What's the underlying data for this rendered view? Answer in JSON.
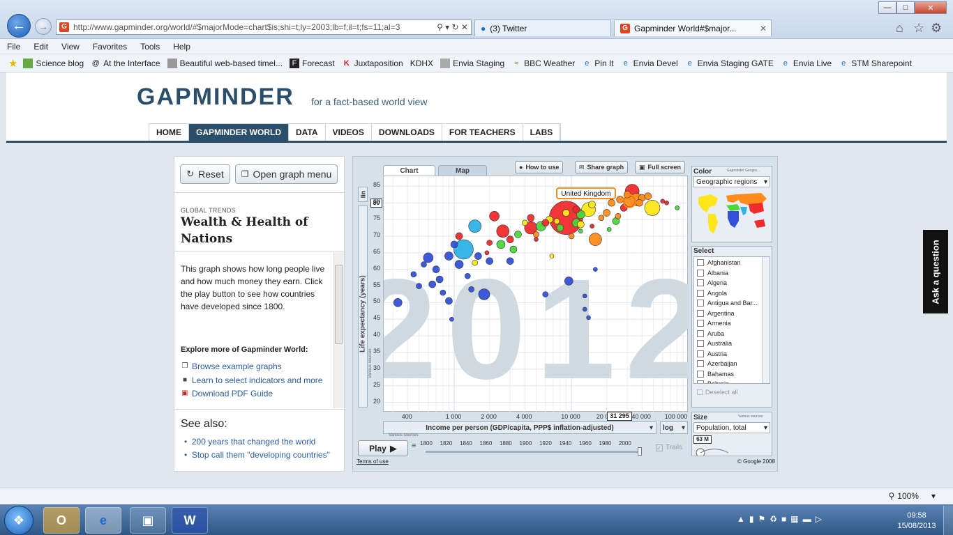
{
  "browser": {
    "url": "http://www.gapminder.org/world/#$majorMode=chart$is;shi=t;ly=2003;lb=f;il=t;fs=11;al=3",
    "tabs": [
      {
        "title": "(3) Twitter"
      },
      {
        "title": "Gapminder World#$major..."
      }
    ],
    "menu": [
      "File",
      "Edit",
      "View",
      "Favorites",
      "Tools",
      "Help"
    ],
    "favorites": [
      "Science blog",
      "At the Interface",
      "Beautiful web-based timel...",
      "Forecast",
      "Juxtaposition",
      "KDHX",
      "Envia Staging",
      "BBC Weather",
      "Pin It",
      "Envia Devel",
      "Envia Staging GATE",
      "Envia Live",
      "STM Sharepoint"
    ],
    "zoom": "100%"
  },
  "site": {
    "logo": "GAPMINDER",
    "tagline": "for a fact-based world view",
    "nav": [
      "HOME",
      "GAPMINDER WORLD",
      "DATA",
      "VIDEOS",
      "DOWNLOADS",
      "FOR TEACHERS",
      "LABS"
    ]
  },
  "left": {
    "reset_label": "Reset",
    "menu_label": "Open graph menu",
    "kicker": "GLOBAL TRENDS",
    "title": "Wealth & Health of Nations",
    "description": "This graph shows how long people live and how much money they earn. Click the play button to see how countries have developed since 1800.",
    "explore": "Explore more of Gapminder World:",
    "links": [
      "Browse example graphs",
      "Learn to select indicators and more",
      "Download PDF Guide"
    ],
    "see_also": "See also:",
    "see_links": [
      "200 years that changed the world",
      "Stop call them \"developing countries\""
    ]
  },
  "widget": {
    "tabs": [
      "Chart",
      "Map"
    ],
    "buttons": [
      "How to use",
      "Share graph",
      "Full screen"
    ],
    "year_watermark": "2012",
    "y_scale": "lin",
    "y_marker": "80",
    "x_marker": "31 295",
    "highlight_label": "United Kingdom",
    "x_axis_select": "Income per person (GDP/capita, PPP$ inflation-adjusted)",
    "x_scale": "log",
    "sources": "Various sources",
    "play": "Play",
    "timeline_years": [
      "1800",
      "1820",
      "1840",
      "1860",
      "1880",
      "1900",
      "1920",
      "1940",
      "1960",
      "1980",
      "2000"
    ],
    "trails": "Trails",
    "terms": "Terms of use",
    "copyright": "© Google 2008",
    "color_title": "Color",
    "color_note": "Gapminder Geogra...",
    "color_select": "Geographic regions",
    "select_title": "Select",
    "countries": [
      "Afghanistan",
      "Albania",
      "Algeria",
      "Angola",
      "Antigua and Bar...",
      "Argentina",
      "Armenia",
      "Aruba",
      "Australia",
      "Austria",
      "Azerbaijan",
      "Bahamas",
      "Bahrain"
    ],
    "deselect": "Deselect all",
    "size_title": "Size",
    "size_select": "Population, total",
    "size_marker": "63 M"
  },
  "ask": "Ask a question",
  "taskbar": {
    "time": "09:58",
    "date": "15/08/2013"
  },
  "chart_data": {
    "type": "scatter",
    "title": "",
    "xlabel": "Income per person (GDP/capita, PPP$ inflation-adjusted)",
    "ylabel": "Life expectancy (years)",
    "x_scale": "log",
    "xlim": [
      250,
      100000
    ],
    "ylim": [
      17,
      88
    ],
    "x_ticks": [
      "400",
      "1 000",
      "2 000",
      "4 000",
      "10 000",
      "20 000",
      "40 000",
      "100 000"
    ],
    "x_tick_values": [
      400,
      1000,
      2000,
      4000,
      10000,
      20000,
      40000,
      100000
    ],
    "y_ticks": [
      85,
      80,
      75,
      70,
      65,
      60,
      55,
      50,
      45,
      40,
      35,
      30,
      25,
      20
    ],
    "year": "2012",
    "colors": {
      "Sub-Saharan Africa": "#3450d8",
      "South Asia": "#2db3e6",
      "Middle East & N. Africa": "#4cd63c",
      "America": "#ffe61a",
      "Europe & Central Asia": "#ff8c1a",
      "East Asia & Pacific": "#ef2b2b"
    },
    "points": [
      {
        "x": 1200,
        "y": 66,
        "r": 14,
        "c": "#2db3e6"
      },
      {
        "x": 9000,
        "y": 75.5,
        "r": 24,
        "c": "#ef2b2b"
      },
      {
        "x": 1500,
        "y": 73,
        "r": 9,
        "c": "#2db3e6"
      },
      {
        "x": 14000,
        "y": 78,
        "r": 10,
        "c": "#ffe61a"
      },
      {
        "x": 49000,
        "y": 78.5,
        "r": 11,
        "c": "#ffe61a"
      },
      {
        "x": 36000,
        "y": 81,
        "r": 9,
        "c": "#ff8c1a"
      },
      {
        "x": 31295,
        "y": 80.5,
        "r": 8,
        "c": "#ff8c1a"
      },
      {
        "x": 33000,
        "y": 83.5,
        "r": 10,
        "c": "#ef2b2b"
      },
      {
        "x": 16000,
        "y": 69,
        "r": 9,
        "c": "#ff8c1a"
      },
      {
        "x": 2600,
        "y": 71.5,
        "r": 9,
        "c": "#ef2b2b"
      },
      {
        "x": 4500,
        "y": 72.5,
        "r": 9,
        "c": "#ef2b2b"
      },
      {
        "x": 2200,
        "y": 76,
        "r": 7,
        "c": "#ef2b2b"
      },
      {
        "x": 1800,
        "y": 52.5,
        "r": 8,
        "c": "#3450d8"
      },
      {
        "x": 9500,
        "y": 56.5,
        "r": 6,
        "c": "#3450d8"
      },
      {
        "x": 330,
        "y": 50,
        "r": 6,
        "c": "#3450d8"
      },
      {
        "x": 600,
        "y": 63.5,
        "r": 7,
        "c": "#3450d8"
      },
      {
        "x": 900,
        "y": 64,
        "r": 6,
        "c": "#3450d8"
      },
      {
        "x": 1100,
        "y": 61.5,
        "r": 6,
        "c": "#3450d8"
      },
      {
        "x": 700,
        "y": 60,
        "r": 5,
        "c": "#3450d8"
      },
      {
        "x": 750,
        "y": 57,
        "r": 5,
        "c": "#3450d8"
      },
      {
        "x": 650,
        "y": 55.5,
        "r": 5,
        "c": "#3450d8"
      },
      {
        "x": 900,
        "y": 50.5,
        "r": 5,
        "c": "#3450d8"
      },
      {
        "x": 450,
        "y": 58.5,
        "r": 4,
        "c": "#3450d8"
      },
      {
        "x": 500,
        "y": 55,
        "r": 4,
        "c": "#3450d8"
      },
      {
        "x": 800,
        "y": 53,
        "r": 4,
        "c": "#3450d8"
      },
      {
        "x": 1300,
        "y": 58,
        "r": 4,
        "c": "#3450d8"
      },
      {
        "x": 1600,
        "y": 64,
        "r": 5,
        "c": "#3450d8"
      },
      {
        "x": 2000,
        "y": 62.5,
        "r": 5,
        "c": "#3450d8"
      },
      {
        "x": 1400,
        "y": 54,
        "r": 4,
        "c": "#3450d8"
      },
      {
        "x": 550,
        "y": 61.5,
        "r": 4,
        "c": "#3450d8"
      },
      {
        "x": 1000,
        "y": 67.5,
        "r": 5,
        "c": "#3450d8"
      },
      {
        "x": 3000,
        "y": 62.5,
        "r": 5,
        "c": "#3450d8"
      },
      {
        "x": 13000,
        "y": 52,
        "r": 3,
        "c": "#3450d8"
      },
      {
        "x": 13000,
        "y": 48,
        "r": 3,
        "c": "#3450d8"
      },
      {
        "x": 14000,
        "y": 45.5,
        "r": 3,
        "c": "#3450d8"
      },
      {
        "x": 16000,
        "y": 60,
        "r": 3,
        "c": "#3450d8"
      },
      {
        "x": 6000,
        "y": 52.5,
        "r": 4,
        "c": "#3450d8"
      },
      {
        "x": 950,
        "y": 45,
        "r": 3,
        "c": "#3450d8"
      },
      {
        "x": 2500,
        "y": 67.5,
        "r": 6,
        "c": "#4cd63c"
      },
      {
        "x": 5500,
        "y": 73,
        "r": 7,
        "c": "#4cd63c"
      },
      {
        "x": 11000,
        "y": 74,
        "r": 6,
        "c": "#4cd63c"
      },
      {
        "x": 8000,
        "y": 72.5,
        "r": 5,
        "c": "#4cd63c"
      },
      {
        "x": 12000,
        "y": 76.5,
        "r": 6,
        "c": "#4cd63c"
      },
      {
        "x": 3500,
        "y": 70.5,
        "r": 5,
        "c": "#4cd63c"
      },
      {
        "x": 3200,
        "y": 66,
        "r": 5,
        "c": "#4cd63c"
      },
      {
        "x": 6500,
        "y": 75,
        "r": 5,
        "c": "#ffe61a"
      },
      {
        "x": 9000,
        "y": 77,
        "r": 5,
        "c": "#ffe61a"
      },
      {
        "x": 15000,
        "y": 79.5,
        "r": 5,
        "c": "#ffe61a"
      },
      {
        "x": 4000,
        "y": 74,
        "r": 4,
        "c": "#ffe61a"
      },
      {
        "x": 7500,
        "y": 74.5,
        "r": 4,
        "c": "#ffe61a"
      },
      {
        "x": 12000,
        "y": 73.5,
        "r": 5,
        "c": "#ffe61a"
      },
      {
        "x": 1500,
        "y": 62,
        "r": 4,
        "c": "#ffe61a"
      },
      {
        "x": 25000,
        "y": 76,
        "r": 4,
        "c": "#ff8c1a"
      },
      {
        "x": 20000,
        "y": 77,
        "r": 5,
        "c": "#ff8c1a"
      },
      {
        "x": 26000,
        "y": 81,
        "r": 5,
        "c": "#ff8c1a"
      },
      {
        "x": 40000,
        "y": 81.5,
        "r": 5,
        "c": "#ff8c1a"
      },
      {
        "x": 45000,
        "y": 82,
        "r": 5,
        "c": "#ff8c1a"
      },
      {
        "x": 22000,
        "y": 80,
        "r": 5,
        "c": "#ff8c1a"
      },
      {
        "x": 18000,
        "y": 75.5,
        "r": 4,
        "c": "#ff8c1a"
      },
      {
        "x": 10000,
        "y": 70,
        "r": 4,
        "c": "#ff8c1a"
      },
      {
        "x": 5000,
        "y": 70.5,
        "r": 4,
        "c": "#ff8c1a"
      },
      {
        "x": 30000,
        "y": 82.5,
        "r": 5,
        "c": "#ff8c1a"
      },
      {
        "x": 38000,
        "y": 80,
        "r": 5,
        "c": "#ff8c1a"
      },
      {
        "x": 28000,
        "y": 78.5,
        "r": 5,
        "c": "#ef2b2b"
      },
      {
        "x": 60000,
        "y": 80.5,
        "r": 3,
        "c": "#ef2b2b"
      },
      {
        "x": 65000,
        "y": 80,
        "r": 3,
        "c": "#ef2b2b"
      },
      {
        "x": 80000,
        "y": 78.5,
        "r": 3,
        "c": "#4cd63c"
      },
      {
        "x": 3000,
        "y": 69,
        "r": 5,
        "c": "#ef2b2b"
      },
      {
        "x": 4500,
        "y": 75.5,
        "r": 5,
        "c": "#ef2b2b"
      },
      {
        "x": 6000,
        "y": 74,
        "r": 5,
        "c": "#ef2b2b"
      },
      {
        "x": 1100,
        "y": 70,
        "r": 5,
        "c": "#ef2b2b"
      },
      {
        "x": 2000,
        "y": 68,
        "r": 4,
        "c": "#ef2b2b"
      },
      {
        "x": 1900,
        "y": 65,
        "r": 3,
        "c": "#ef2b2b"
      },
      {
        "x": 5000,
        "y": 69,
        "r": 3,
        "c": "#ef2b2b"
      },
      {
        "x": 11000,
        "y": 78,
        "r": 5,
        "c": "#ef2b2b"
      },
      {
        "x": 15000,
        "y": 73,
        "r": 3,
        "c": "#ef2b2b"
      },
      {
        "x": 6800,
        "y": 64,
        "r": 3,
        "c": "#ffe61a"
      },
      {
        "x": 12000,
        "y": 71.5,
        "r": 3,
        "c": "#4cd63c"
      },
      {
        "x": 21000,
        "y": 72,
        "r": 3,
        "c": "#4cd63c"
      },
      {
        "x": 24000,
        "y": 74.5,
        "r": 5,
        "c": "#4cd63c"
      }
    ]
  }
}
